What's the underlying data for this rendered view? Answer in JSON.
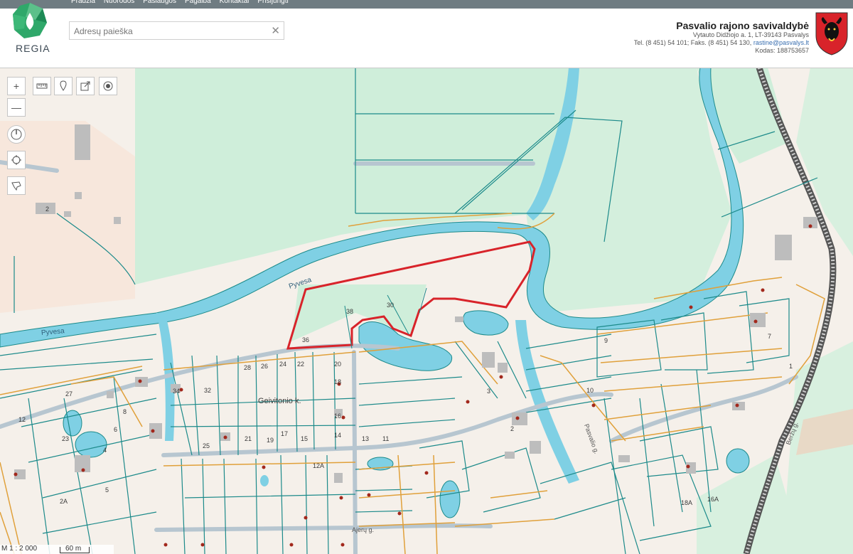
{
  "header": {
    "nav": [
      "Pradžia",
      "Nuorodos",
      "Paslaugos",
      "Pagalba",
      "Kontaktai",
      "Prisijungti"
    ],
    "logo_text": "REGIA",
    "search": {
      "placeholder": "Adresų paieška",
      "value": ""
    },
    "clear_icon": "close-icon",
    "municipality": {
      "name": "Pasvalio rajono savivaldybė",
      "address": "Vytauto Didžiojo a. 1, LT-39143 Pasvalys",
      "phones": "Tel. (8 451) 54 101; Faks. (8 451) 54 130,",
      "email": "rastine@pasvalys.lt",
      "code": "Kodas: 188753657"
    }
  },
  "toolbar": {
    "zoom_in": "+",
    "zoom_out": "—",
    "tools": [
      "measure-icon",
      "marker-icon",
      "share-icon",
      "layers-icon",
      "compass-icon",
      "locate-icon",
      "area-icon"
    ]
  },
  "map": {
    "rivers": [
      "Pyvesa",
      "Pyvesa"
    ],
    "village": "Geivitonio k.",
    "streets": [
      "Ajerų g.",
      "Beržų g.",
      "Pasvalio g."
    ],
    "parcels": [
      "30",
      "38",
      "36",
      "28",
      "26",
      "24",
      "22",
      "20",
      "18",
      "16",
      "14",
      "32",
      "34",
      "27",
      "25",
      "23",
      "21",
      "19",
      "17",
      "15",
      "13",
      "12",
      "11",
      "10",
      "9",
      "8",
      "7",
      "6",
      "5",
      "4",
      "3",
      "2",
      "2A",
      "12A",
      "18A",
      "16A",
      "1",
      "2"
    ],
    "colors": {
      "water": "#7fd0e4",
      "parcel_line": "#1c8a8a",
      "orange_line": "#e0a03a",
      "highlight": "#d8232a",
      "forest": "#d6efdd"
    }
  },
  "scale": {
    "ratio": "M 1 : 2 000",
    "length": "60 m"
  }
}
